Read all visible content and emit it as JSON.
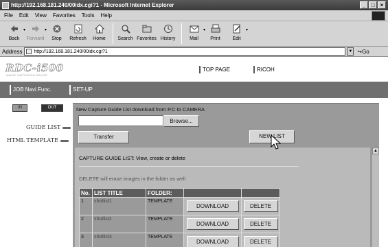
{
  "window": {
    "title": "http://192.168.181.240/00idx.cgi?1 - Microsoft Internet Explorer",
    "buttons": [
      "_",
      "□",
      "×"
    ]
  },
  "menu": [
    "File",
    "Edit",
    "View",
    "Favorites",
    "Tools",
    "Help"
  ],
  "toolbar": [
    {
      "label": "Back",
      "icon": "back-arrow-icon",
      "dropdown": true
    },
    {
      "label": "Forward",
      "icon": "forward-arrow-icon",
      "dropdown": true,
      "disabled": true
    },
    {
      "label": "Stop",
      "icon": "stop-icon"
    },
    {
      "label": "Refresh",
      "icon": "refresh-icon"
    },
    {
      "label": "Home",
      "icon": "home-icon"
    },
    {
      "label": "Search",
      "icon": "search-icon"
    },
    {
      "label": "Favorites",
      "icon": "favorites-icon"
    },
    {
      "label": "History",
      "icon": "history-icon"
    },
    {
      "label": "Mail",
      "icon": "mail-icon",
      "dropdown": true
    },
    {
      "label": "Print",
      "icon": "print-icon"
    },
    {
      "label": "Edit",
      "icon": "edit-icon",
      "dropdown": true
    }
  ],
  "address": {
    "label": "Address",
    "url": "http://192.168.181.240/00idx.cgi?1",
    "go": "Go"
  },
  "site": {
    "logo": "RDC-i500",
    "logo_sub": "IMAGE CAPTURING DEVICE",
    "top_links": [
      "TOP PAGE",
      "RICOH"
    ],
    "nav": [
      "JOB Navi Func.",
      "SET-UP"
    ]
  },
  "sidebar": {
    "mode_buttons": [
      "IN",
      "OUT"
    ],
    "links": [
      "GUIDE LIST",
      "HTML TEMPLATE"
    ]
  },
  "content": {
    "heading": "New Capture Guide List download from P.C to CAMERA",
    "browse_label": "Browse...",
    "transfer_label": "Transfer",
    "new_list_label": "NEW LIST",
    "section_title": "CAPTURE GUIDE LIST: View, create or delete",
    "warning": "DELETE will erase images in the folder as well",
    "table": {
      "headers": [
        "No.",
        "LIST TITLE",
        "FOLDER:",
        "",
        ""
      ],
      "rows": [
        {
          "no": "1",
          "title": "shotlist1",
          "folder": "TEMPLATE",
          "download": "DOWNLOAD",
          "delete": "DELETE"
        },
        {
          "no": "2",
          "title": "shotlist2",
          "folder": "TEMPLATE",
          "download": "DOWNLOAD",
          "delete": "DELETE"
        },
        {
          "no": "3",
          "title": "shotlist3",
          "folder": "TEMPLATE",
          "download": "DOWNLOAD",
          "delete": "DELETE"
        }
      ]
    }
  },
  "colors": {
    "chrome": "#d4d4d4",
    "navbar": "#6f6f6f",
    "content_bg": "#9a9a9a",
    "table_header": "#5c5c5c"
  }
}
